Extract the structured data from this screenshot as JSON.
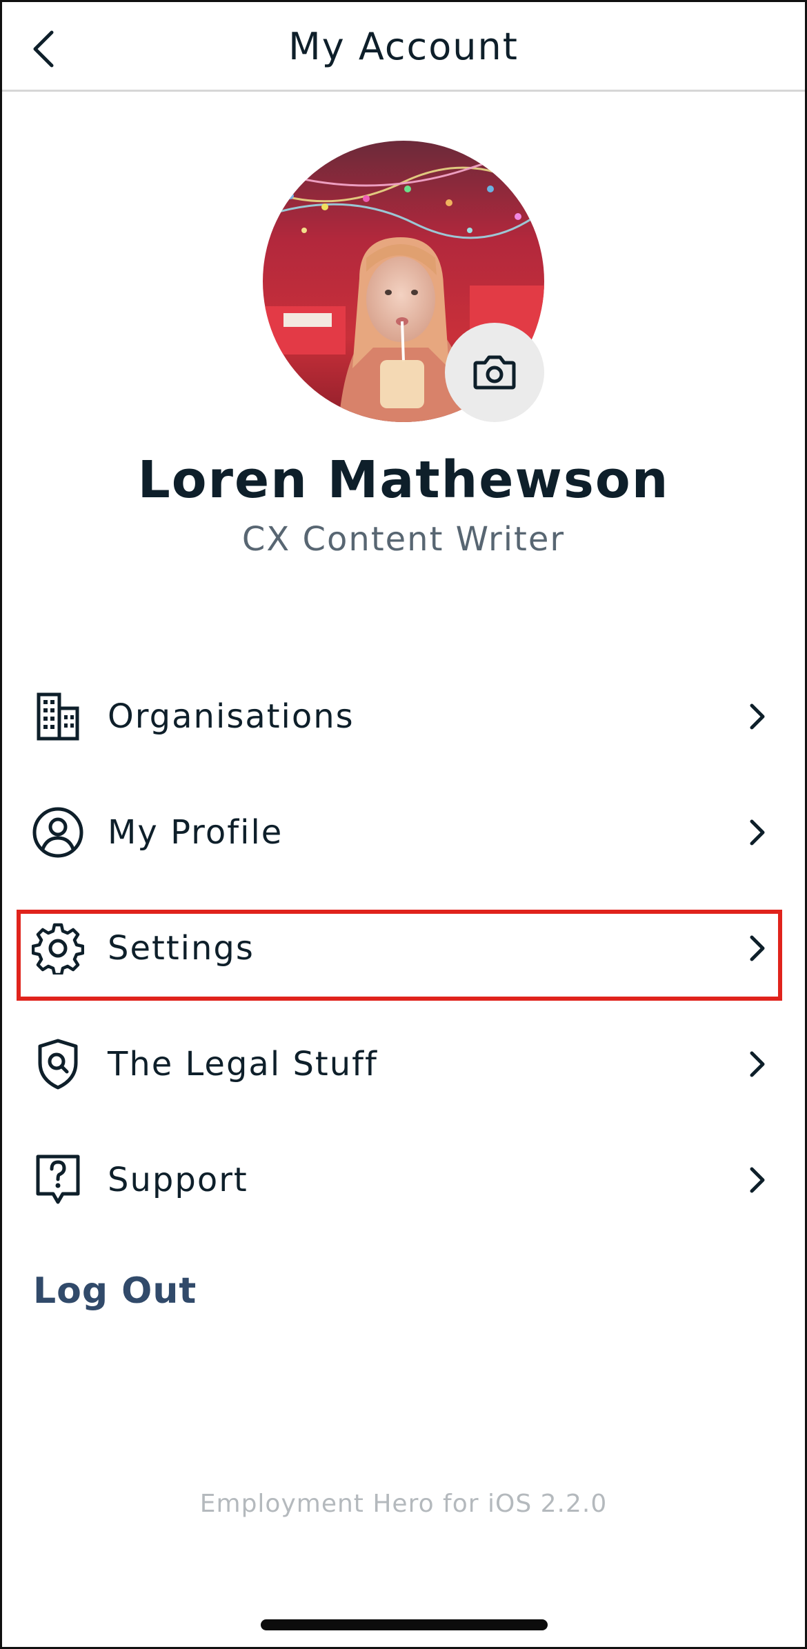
{
  "header": {
    "title": "My Account",
    "back_icon": "chevron-left-icon"
  },
  "profile": {
    "name": "Loren Mathewson",
    "role": "CX Content Writer",
    "camera_icon": "camera-icon"
  },
  "menu": {
    "items": [
      {
        "label": "Organisations",
        "icon": "building-icon"
      },
      {
        "label": "My Profile",
        "icon": "user-circle-icon"
      },
      {
        "label": "Settings",
        "icon": "gear-icon",
        "highlighted": true
      },
      {
        "label": "The Legal Stuff",
        "icon": "shield-search-icon"
      },
      {
        "label": "Support",
        "icon": "question-bubble-icon"
      }
    ]
  },
  "logout_label": "Log Out",
  "version": "Employment Hero for iOS 2.2.0",
  "colors": {
    "text": "#0e1f2a",
    "subtle_text": "#586672",
    "logout": "#314a6a",
    "highlight": "#e0231c",
    "version": "#b4b9bd"
  }
}
